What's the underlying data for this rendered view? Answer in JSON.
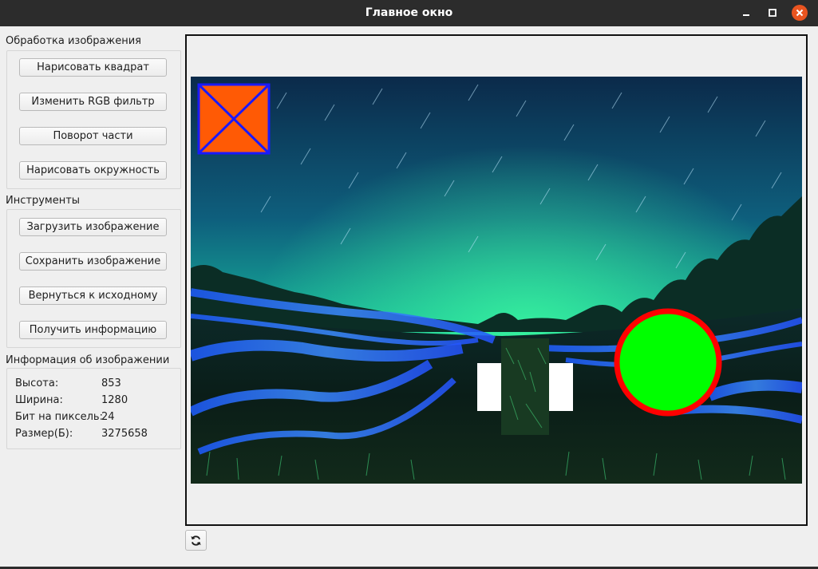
{
  "window": {
    "title": "Главное окно"
  },
  "processing": {
    "label": "Обработка изображения",
    "buttons": [
      "Нарисовать квадрат",
      "Изменить RGB фильтр",
      "Поворот части",
      "Нарисовать окружность"
    ]
  },
  "tools": {
    "label": "Инструменты",
    "buttons": [
      "Загрузить изображение",
      "Сохранить изображение",
      "Вернуться к исходному",
      "Получить информацию"
    ]
  },
  "info": {
    "label": "Информация об изображении",
    "rows": [
      {
        "label": "Высота:",
        "value": "853"
      },
      {
        "label": "Ширина:",
        "value": "1280"
      },
      {
        "label": "Бит на пиксель:",
        "value": "24"
      },
      {
        "label": "Размер(Б):",
        "value": "3275658"
      }
    ]
  },
  "colors": {
    "square_fill": "#ff5a05",
    "square_border": "#1a1aff",
    "circle_fill": "#00ff00",
    "circle_border": "#ff0000",
    "close_button": "#e95420"
  },
  "icons": {
    "minimize": "minimize-icon",
    "maximize": "maximize-icon",
    "close": "close-icon",
    "refresh": "refresh-icon"
  }
}
